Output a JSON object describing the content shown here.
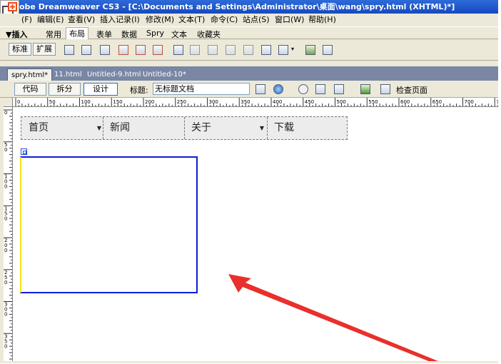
{
  "window": {
    "title": "obe Dreamweaver CS3 - [C:\\Documents and Settings\\Administrator\\桌面\\wang\\spry.html (XHTML)*]"
  },
  "menubar": {
    "items": [
      "(F)",
      "编辑(E)",
      "查看(V)",
      "插入记录(I)",
      "修改(M)",
      "文本(T)",
      "命令(C)",
      "站点(S)",
      "窗口(W)",
      "帮助(H)"
    ]
  },
  "insertbar": {
    "toggle": "▼插入",
    "tabs": [
      "常用",
      "布局",
      "表单",
      "数据",
      "Spry",
      "文本",
      "收藏夹"
    ]
  },
  "layout_toolbar": {
    "buttons": [
      "标准",
      "扩展"
    ]
  },
  "doc_tabs": [
    "spry.html*",
    "11.html",
    "Untitled-9.html",
    "Untitled-10*"
  ],
  "doc_toolbar": {
    "views": [
      "代码",
      "拆分",
      "设计"
    ],
    "title_label": "标题:",
    "title_value": "无标题文档",
    "check_page": "检查页面"
  },
  "ruler": {
    "h_labels": [
      "0",
      "50",
      "100",
      "150",
      "200",
      "250",
      "300",
      "350",
      "400",
      "450",
      "500",
      "550",
      "600",
      "650",
      "700",
      "75"
    ],
    "v_labels": [
      "0",
      "5\n0",
      "1\n0\n0",
      "1\n5\n0",
      "2\n0\n0",
      "2\n5\n0",
      "3\n0\n0",
      "3\n5\n0"
    ]
  },
  "spry_menu": {
    "items": [
      "首页",
      "新闻",
      "关于",
      "下载"
    ],
    "has_submenu": [
      true,
      false,
      true,
      false
    ]
  },
  "colors": {
    "panel_border": "#0a1fd6",
    "annotation_arrow": "#e8302c",
    "titlebar": "#1c56cf",
    "tabbar": "#7987a4"
  }
}
